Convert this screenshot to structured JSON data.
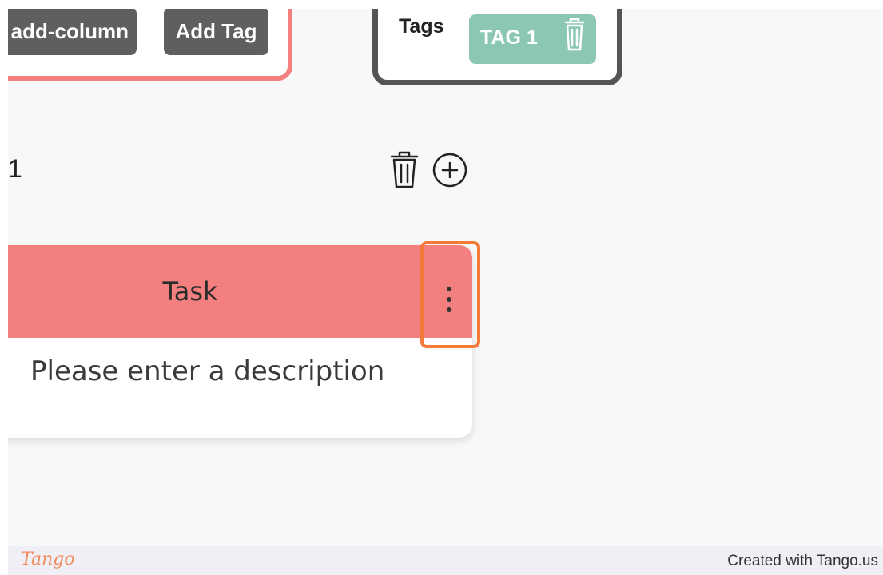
{
  "toolbar": {
    "add_column_label": "add-column",
    "add_tag_label": "Add Tag",
    "border_color": "#f47f7f",
    "button_color": "#5f5f5f"
  },
  "tags_panel": {
    "label": "Tags",
    "tags": [
      {
        "label": "TAG 1",
        "color": "#8cc7b3",
        "icon": "trash-icon"
      }
    ]
  },
  "column": {
    "title": "1",
    "actions": [
      {
        "icon": "trash-icon"
      },
      {
        "icon": "plus-circle-icon"
      }
    ]
  },
  "task": {
    "title": "Task",
    "header_color": "#f47f7f",
    "description": "Please enter a description",
    "menu_icon": "vertical-dots-icon"
  },
  "highlight": {
    "color": "#f47a3a"
  },
  "footer": {
    "logo": "Tango",
    "credit": "Created with Tango.us"
  }
}
